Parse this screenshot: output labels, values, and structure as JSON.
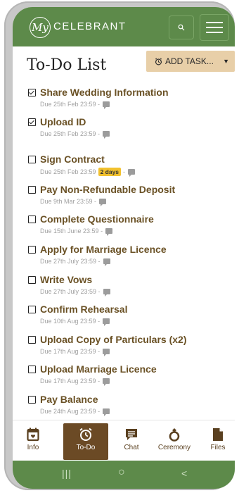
{
  "app": {
    "logo_text": "My",
    "brand": "CELEBRANT"
  },
  "page": {
    "title": "To-Do List"
  },
  "add_task": {
    "label": "ADD TASK...",
    "caret": "▼",
    "icon": "alarm-clock-icon"
  },
  "tasks": [
    {
      "name": "Share Wedding Information",
      "due": "Due 25th Feb 23:59 -",
      "checked": true
    },
    {
      "name": "Upload ID",
      "due": "Due 25th Feb 23:59 -",
      "checked": true
    },
    {
      "name": "Sign Contract",
      "due": "Due 25th Feb 23:59",
      "badge": "2 days",
      "suffix": "-",
      "checked": false
    },
    {
      "name": "Pay Non-Refundable Deposit",
      "due": "Due 9th Mar 23:59 -",
      "checked": false
    },
    {
      "name": "Complete Questionnaire",
      "due": "Due 15th June 23:59 -",
      "checked": false
    },
    {
      "name": "Apply for Marriage Licence",
      "due": "Due 27th July 23:59 -",
      "checked": false
    },
    {
      "name": "Write Vows",
      "due": "Due 27th July 23:59 -",
      "checked": false
    },
    {
      "name": "Confirm Rehearsal",
      "due": "Due 10th Aug 23:59 -",
      "checked": false
    },
    {
      "name": "Upload Copy of Particulars (x2)",
      "due": "Due 17th Aug 23:59 -",
      "checked": false
    },
    {
      "name": "Upload Marriage Licence",
      "due": "Due 17th Aug 23:59 -",
      "checked": false
    },
    {
      "name": "Pay Balance",
      "due": "Due 24th Aug 23:59 -",
      "checked": false
    }
  ],
  "nav": [
    {
      "label": "Info",
      "icon": "calendar-icon",
      "active": false
    },
    {
      "label": "To-Do",
      "icon": "alarm-clock-icon",
      "active": true
    },
    {
      "label": "Chat",
      "icon": "chat-icon",
      "active": false
    },
    {
      "label": "Ceremony",
      "icon": "ring-icon",
      "active": false
    },
    {
      "label": "Files",
      "icon": "file-icon",
      "active": false
    }
  ],
  "system_nav": {
    "recents": "|||",
    "home": "○",
    "back": "<"
  },
  "colors": {
    "green": "#5d8a4a",
    "brown": "#6b4a25",
    "task_text": "#6a5125",
    "add_task_bg": "#e8cfa8",
    "badge": "#f2c12e"
  }
}
